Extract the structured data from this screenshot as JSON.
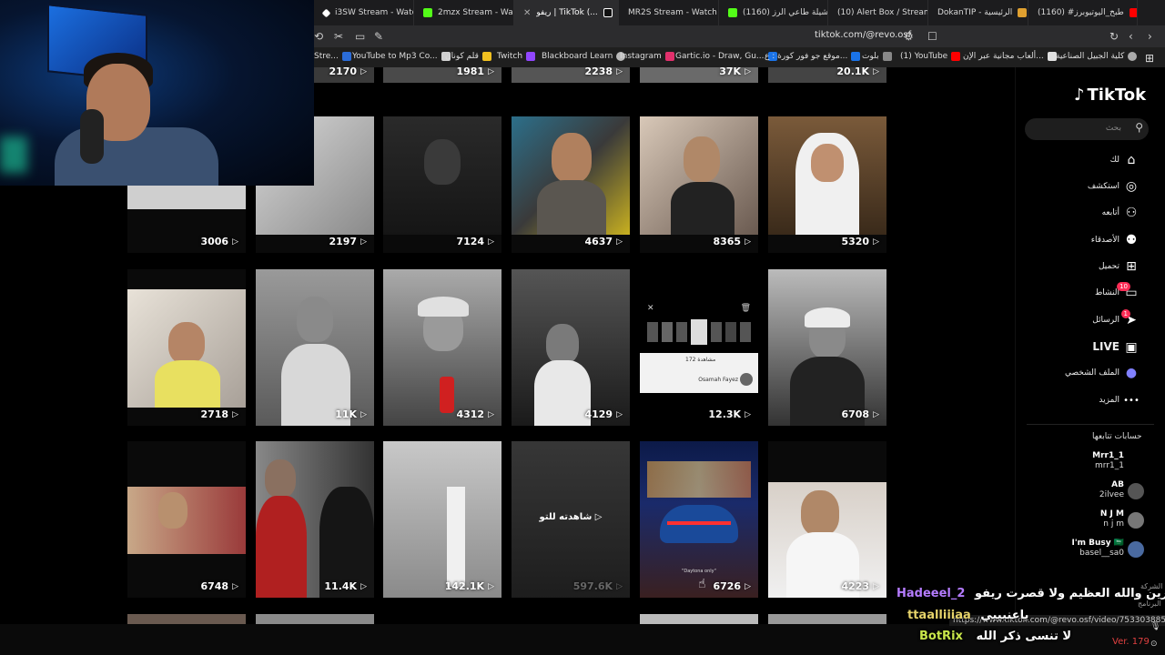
{
  "browser": {
    "tabs": [
      {
        "label": "i3SW Stream - Watch",
        "color": "#ffffff"
      },
      {
        "label": "2mzx Stream - Watch",
        "color": "#53fc18"
      },
      {
        "label": "ريفو | TikTok (...",
        "color": "#ffffff",
        "active": true
      },
      {
        "label": "MR2S Stream - Watch",
        "color": "#53fc18"
      },
      {
        "label": "(1160) شيلة طاعي الرز...",
        "color": "#ff0000"
      },
      {
        "label": "(10) Alert Box / Stream",
        "color": "#31c3a2"
      },
      {
        "label": "DokanTIP - الرئيسية",
        "color": "#e0a030"
      },
      {
        "label": "(1160) #طبخ_اليوتيوبرز",
        "color": "#ff0000"
      }
    ],
    "url": "tiktok.com/@revo.osf",
    "bookmarks": [
      {
        "label": "Stre...",
        "color": "#2b6cd8"
      },
      {
        "label": "YouTube to Mp3 Co...",
        "color": "#d0d0d0"
      },
      {
        "label": "قلم كونان",
        "color": "#f0c020"
      },
      {
        "label": "Twitch",
        "color": "#9146ff"
      },
      {
        "label": "Blackboard Learn",
        "color": "#bbbbbb"
      },
      {
        "label": "Instagram",
        "color": "#e1306c"
      },
      {
        "label": "Gartic.io - Draw, Gu...",
        "color": "#1a73e8"
      },
      {
        "label": "موقع جو فور كورة : ع...",
        "color": "#1a73e8"
      },
      {
        "label": "بلوت",
        "color": "#888888"
      },
      {
        "label": "(1) YouTube",
        "color": "#ff0000"
      },
      {
        "label": "ألعاب مجانية عبر الإن...",
        "color": "#e0e0e0"
      },
      {
        "label": "كلية الجبيل الصناعية",
        "color": "#aaaaaa"
      }
    ]
  },
  "grid": {
    "top_counts": [
      "2170",
      "1981",
      "2238",
      "37K",
      "20.1K"
    ],
    "rows": [
      [
        "3006",
        "2197",
        "7124",
        "4637",
        "8365",
        "5320"
      ],
      [
        "2718",
        "11K",
        "4312",
        "4129",
        "12.3K",
        "6708"
      ],
      [
        "6748",
        "11.4K",
        "142.1K",
        "597.6K",
        "6726",
        "4223"
      ]
    ],
    "watched_label": "شاهدته للتو",
    "popup_views": "172 مشاهدة",
    "popup_name": "Osamah Fayez",
    "car_caption": "\"Daytona only\""
  },
  "sidebar": {
    "logo": "TikTok",
    "search_placeholder": "بحث",
    "nav": [
      {
        "label": "لك",
        "icon": "home-icon",
        "glyph": "⌂"
      },
      {
        "label": "استكشف",
        "icon": "compass-icon",
        "glyph": "◎"
      },
      {
        "label": "أتابعه",
        "icon": "user-plus-icon",
        "glyph": "⚇"
      },
      {
        "label": "الأصدقاء",
        "icon": "friends-icon",
        "glyph": "⚉"
      },
      {
        "label": "تحميل",
        "icon": "upload-icon",
        "glyph": "⊞"
      },
      {
        "label": "النشاط",
        "icon": "activity-icon",
        "glyph": "▭",
        "badge": "10"
      },
      {
        "label": "الرسائل",
        "icon": "messages-icon",
        "glyph": "➤",
        "badge": "1"
      },
      {
        "label": "LIVE",
        "icon": "live-icon",
        "glyph": "▣"
      },
      {
        "label": "الملف الشخصي",
        "icon": "profile-icon",
        "glyph": "●"
      },
      {
        "label": "المزيد",
        "icon": "more-icon",
        "glyph": "•••"
      }
    ],
    "following_title": "حسابات تتابعها",
    "accounts": [
      {
        "name": "Mrr1_1",
        "handle": "mrr1_1"
      },
      {
        "name": "AB",
        "handle": "2ilvee"
      },
      {
        "name": "N J M",
        "handle": "n j m"
      },
      {
        "name": "I'm Busy 🇸🇦",
        "handle": "basel__sa0"
      }
    ],
    "footer_1": "الشركة",
    "footer_2": "البرنامج"
  },
  "chat": [
    {
      "user": "Hadeeel_2",
      "message": "منورين والله العظيم ولا قصرت ريفو",
      "user_color": "#b57cff"
    },
    {
      "user": "ttaalliiiaa",
      "message": "ياعنيييي",
      "user_color": "#e6d36a"
    },
    {
      "user": "BotRix",
      "message": "لا تنسى ذكر الله",
      "user_color": "#c8e64a"
    }
  ],
  "status_url": "https://www.tiktok.com/@revo.osf/video/7533038858858958009",
  "version": "Ver. 179"
}
